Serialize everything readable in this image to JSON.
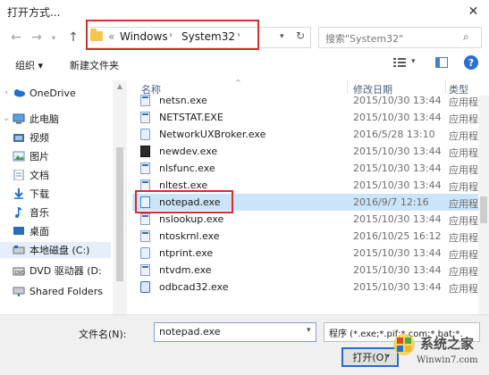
{
  "window": {
    "title": "打开方式..."
  },
  "nav": {
    "back": "←",
    "forward": "→",
    "up": "↑",
    "breadcrumb_prefix": "«",
    "crumbs": [
      "Windows",
      "System32"
    ],
    "refresh": "↻",
    "search_placeholder": "搜索\"System32\""
  },
  "toolbar": {
    "organize": "组织 ▾",
    "new_folder": "新建文件夹"
  },
  "sidebar": {
    "items": [
      {
        "label": "OneDrive"
      },
      {
        "label": "此电脑"
      },
      {
        "label": "视频"
      },
      {
        "label": "图片"
      },
      {
        "label": "文档"
      },
      {
        "label": "下载"
      },
      {
        "label": "音乐"
      },
      {
        "label": "桌面"
      },
      {
        "label": "本地磁盘 (C:)"
      },
      {
        "label": "DVD 驱动器 (D:"
      },
      {
        "label": "Shared Folders"
      }
    ]
  },
  "list": {
    "columns": {
      "name": "名称",
      "date": "修改日期",
      "type": "类型"
    },
    "rows": [
      {
        "name": "netsn.exe",
        "date": "2015/10/30 13:44",
        "type": "应用程"
      },
      {
        "name": "NETSTAT.EXE",
        "date": "2015/10/30 13:44",
        "type": "应用程"
      },
      {
        "name": "NetworkUXBroker.exe",
        "date": "2016/5/28 13:10",
        "type": "应用程"
      },
      {
        "name": "newdev.exe",
        "date": "2015/10/30 13:44",
        "type": "应用程"
      },
      {
        "name": "nlsfunc.exe",
        "date": "2015/10/30 13:44",
        "type": "应用程"
      },
      {
        "name": "nltest.exe",
        "date": "2015/10/30 13:44",
        "type": "应用程"
      },
      {
        "name": "notepad.exe",
        "date": "2016/9/7 12:16",
        "type": "应用程"
      },
      {
        "name": "nslookup.exe",
        "date": "2015/10/30 13:44",
        "type": "应用程"
      },
      {
        "name": "ntoskrnl.exe",
        "date": "2016/10/25 16:12",
        "type": "应用程"
      },
      {
        "name": "ntprint.exe",
        "date": "2015/10/30 13:44",
        "type": "应用程"
      },
      {
        "name": "ntvdm.exe",
        "date": "2015/10/30 13:44",
        "type": "应用程"
      },
      {
        "name": "odbcad32.exe",
        "date": "2015/10/30 13:44",
        "type": "应用程"
      }
    ]
  },
  "footer": {
    "filename_label": "文件名(N):",
    "filename_value": "notepad.exe",
    "filetype_value": "程序 (*.exe;*.pif;*.com;*.bat;*.",
    "open_label": "打开(O)"
  },
  "watermark": {
    "line1": "系统之家",
    "line2": "Winwin7.com"
  },
  "colors": {
    "highlight_red": "#d32d2d",
    "selection": "#cce4f7",
    "accent": "#1f6fd1"
  }
}
